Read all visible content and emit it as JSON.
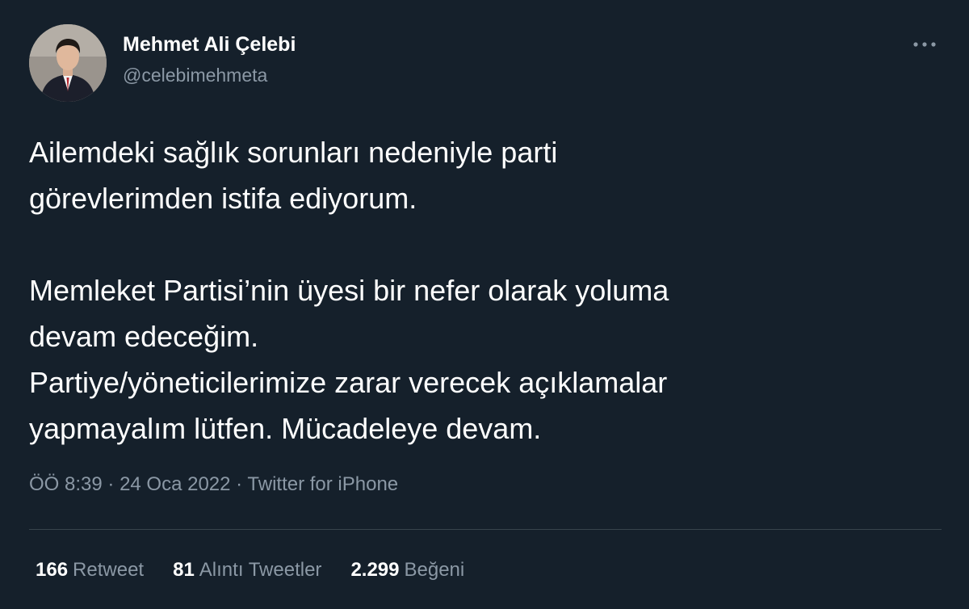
{
  "author": {
    "display_name": "Mehmet Ali Çelebi",
    "handle": "@celebimehmeta",
    "avatar_icon": "profile-photo"
  },
  "menu_icon": "more-dots-icon",
  "tweet": {
    "paragraph1": [
      "Ailemdeki sağlık sorunları nedeniyle parti",
      "görevlerimden istifa ediyorum."
    ],
    "paragraph2": [
      "Memleket Partisi’nin üyesi bir nefer olarak yoluma",
      "devam edeceğim.",
      "Partiye/yöneticilerimize zarar verecek açıklamalar",
      "yapmayalım lütfen. Mücadeleye devam."
    ]
  },
  "meta": {
    "time": "ÖÖ 8:39",
    "date": "24 Oca 2022",
    "source": "Twitter for iPhone"
  },
  "stats": {
    "retweets": {
      "count": "166",
      "label": "Retweet"
    },
    "quotes": {
      "count": "81",
      "label": "Alıntı Tweetler"
    },
    "likes": {
      "count": "2.299",
      "label": "Beğeni"
    }
  },
  "colors": {
    "background": "#15202b",
    "text": "#ffffff",
    "secondary": "#8b98a5",
    "divider": "#38444d"
  }
}
